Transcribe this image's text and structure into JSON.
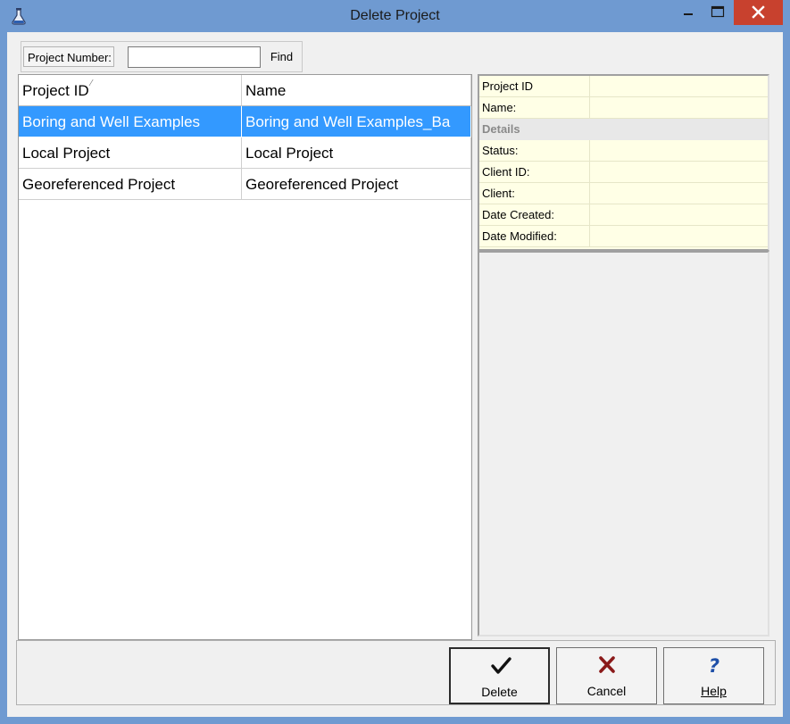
{
  "window": {
    "title": "Delete Project"
  },
  "toolbar": {
    "project_number_label": "Project Number:",
    "project_number_value": "",
    "find_label": "Find"
  },
  "grid": {
    "columns": [
      "Project ID",
      "Name"
    ],
    "rows": [
      {
        "project_id": "Boring and Well Examples",
        "name": "Boring and Well Examples_Ba",
        "selected": true
      },
      {
        "project_id": "Local Project",
        "name": "Local Project",
        "selected": false
      },
      {
        "project_id": "Georeferenced Project",
        "name": "Georeferenced Project",
        "selected": false
      }
    ]
  },
  "properties": {
    "project_id_label": "Project ID",
    "name_label": "Name:",
    "details_header": "Details",
    "status_label": "Status:",
    "client_id_label": "Client ID:",
    "client_label": "Client:",
    "date_created_label": "Date Created:",
    "date_modified_label": "Date Modified:",
    "project_id_value": "",
    "name_value": "",
    "status_value": "",
    "client_id_value": "",
    "client_value": "",
    "date_created_value": "",
    "date_modified_value": ""
  },
  "buttons": {
    "delete_label": "Delete",
    "cancel_label": "Cancel",
    "help_label": "Help"
  },
  "colors": {
    "title_bar": "#6f9ad1",
    "close_button": "#c8412e",
    "selection": "#3399ff",
    "property_background": "#ffffe6",
    "delete_icon": "#111111",
    "cancel_icon": "#8b1a1a",
    "help_icon": "#1e4fa8"
  },
  "icons": {
    "app": "flask-icon",
    "delete": "checkmark-icon",
    "cancel": "x-icon",
    "help": "question-mark-icon"
  }
}
